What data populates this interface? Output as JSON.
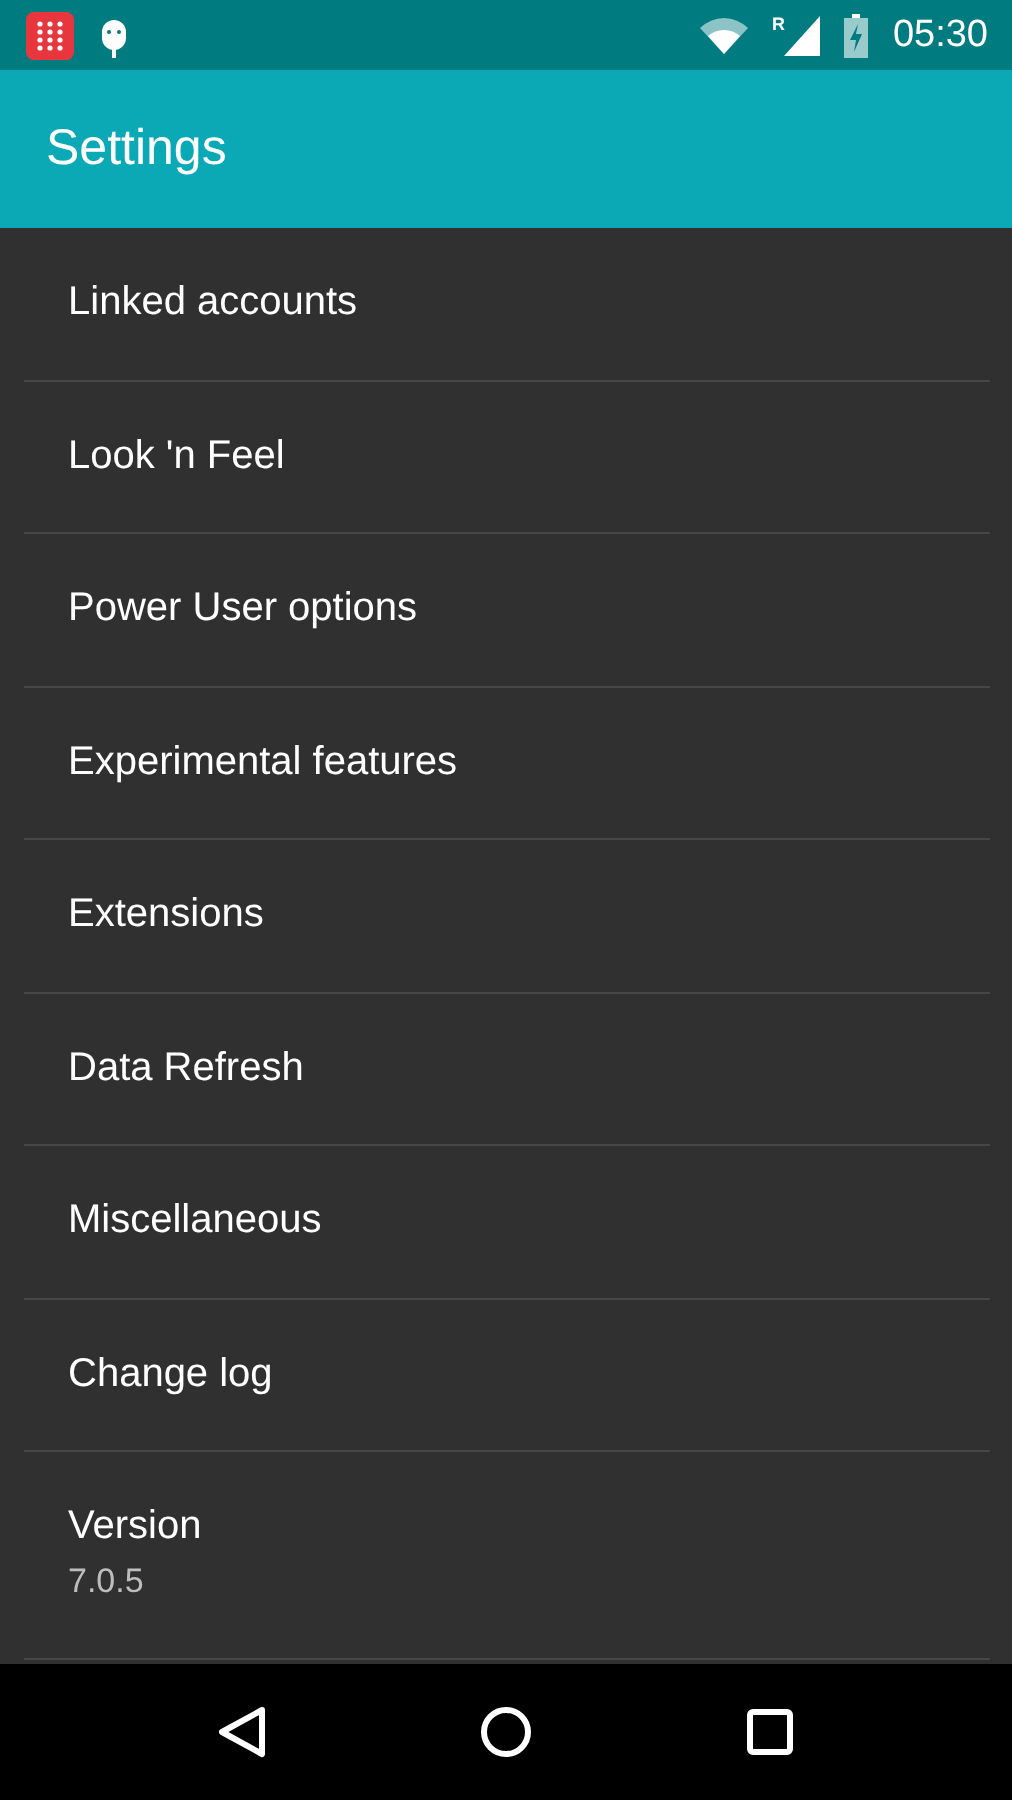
{
  "status_bar": {
    "network_badge": "R",
    "time": "05:30"
  },
  "app_bar": {
    "title": "Settings"
  },
  "items": [
    {
      "title": "Linked accounts"
    },
    {
      "title": "Look 'n Feel"
    },
    {
      "title": "Power User options"
    },
    {
      "title": "Experimental features"
    },
    {
      "title": "Extensions"
    },
    {
      "title": "Data Refresh"
    },
    {
      "title": "Miscellaneous"
    },
    {
      "title": "Change log"
    },
    {
      "title": "Version",
      "summary": "7.0.5"
    }
  ]
}
